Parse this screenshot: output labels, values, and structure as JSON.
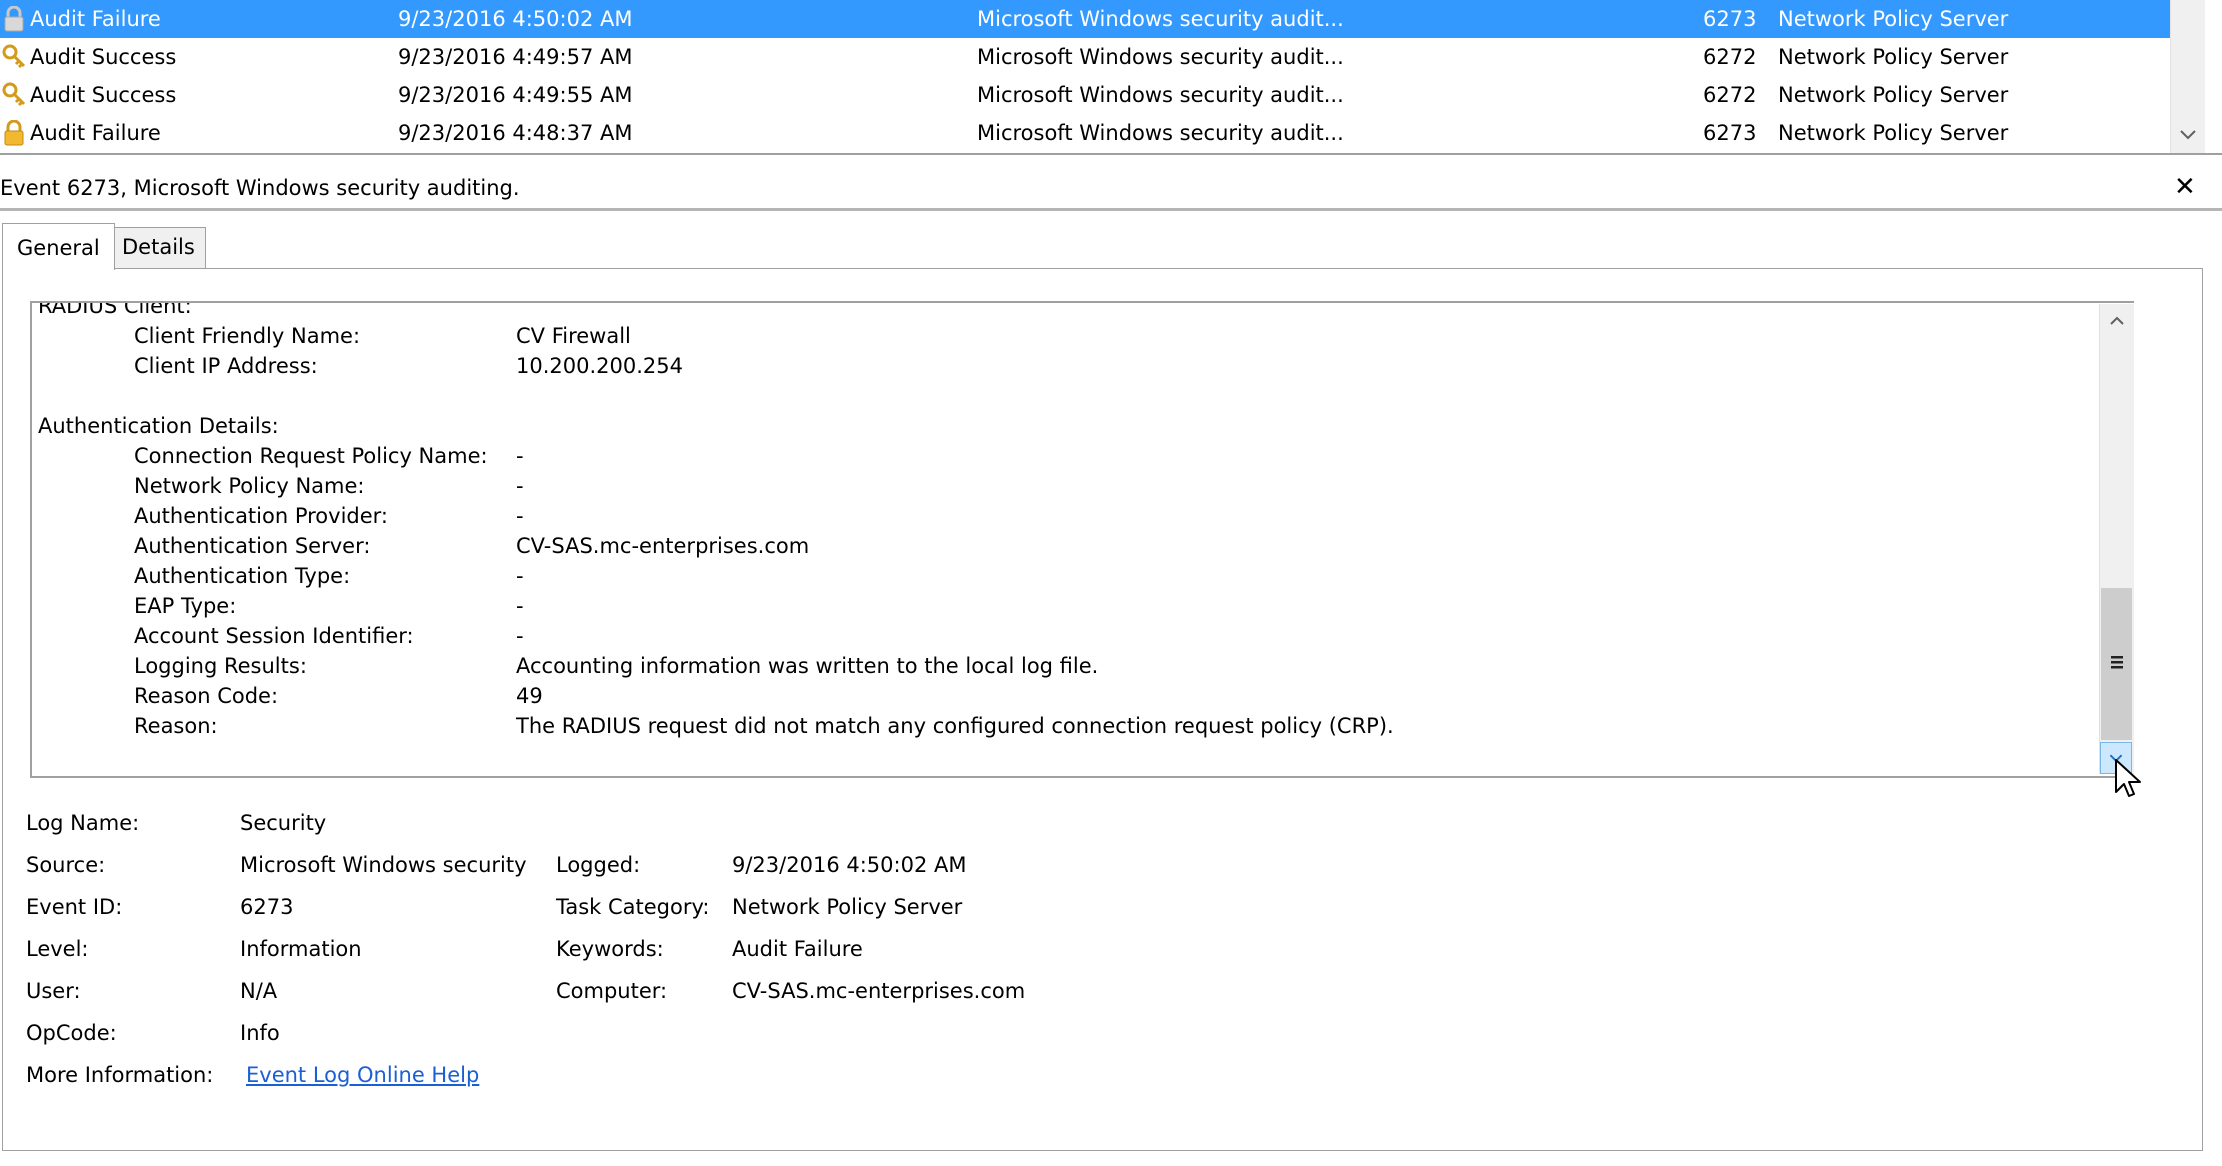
{
  "event_list": {
    "rows": [
      {
        "level": "Audit Failure",
        "date": "9/23/2016 4:50:02 AM",
        "source": "Microsoft Windows security audit...",
        "event_id": "6273",
        "category": "Network Policy Server",
        "icon": "lock-icon",
        "selected": true
      },
      {
        "level": "Audit Success",
        "date": "9/23/2016 4:49:57 AM",
        "source": "Microsoft Windows security audit...",
        "event_id": "6272",
        "category": "Network Policy Server",
        "icon": "key-icon",
        "selected": false
      },
      {
        "level": "Audit Success",
        "date": "9/23/2016 4:49:55 AM",
        "source": "Microsoft Windows security audit...",
        "event_id": "6272",
        "category": "Network Policy Server",
        "icon": "key-icon",
        "selected": false
      },
      {
        "level": "Audit Failure",
        "date": "9/23/2016 4:48:37 AM",
        "source": "Microsoft Windows security audit...",
        "event_id": "6273",
        "category": "Network Policy Server",
        "icon": "lock-icon",
        "selected": false
      }
    ]
  },
  "preview": {
    "title": "Event 6273, Microsoft Windows security auditing.",
    "close_glyph": "✕",
    "tabs": {
      "general": "General",
      "details": "Details"
    },
    "description": {
      "partial_header": "RADIUS Client:",
      "client": [
        {
          "key": "Client Friendly Name:",
          "value": "CV Firewall"
        },
        {
          "key": "Client IP Address:",
          "value": "10.200.200.254"
        }
      ],
      "auth_header": "Authentication Details:",
      "auth": [
        {
          "key": "Connection Request Policy Name:",
          "value": "-"
        },
        {
          "key": "Network Policy Name:",
          "value": "-"
        },
        {
          "key": "Authentication Provider:",
          "value": "-"
        },
        {
          "key": "Authentication Server:",
          "value": "CV-SAS.mc-enterprises.com"
        },
        {
          "key": "Authentication Type:",
          "value": "-"
        },
        {
          "key": "EAP Type:",
          "value": "-"
        },
        {
          "key": "Account Session Identifier:",
          "value": "-"
        },
        {
          "key": "Logging Results:",
          "value": "Accounting information was written to the local log file."
        },
        {
          "key": "Reason Code:",
          "value": "49"
        },
        {
          "key": "Reason:",
          "value": "The RADIUS request did not match any configured connection request policy (CRP)."
        }
      ]
    },
    "properties": {
      "log_name_label": "Log Name:",
      "log_name": "Security",
      "source_label": "Source:",
      "source": "Microsoft Windows security",
      "logged_label": "Logged:",
      "logged": "9/23/2016 4:50:02 AM",
      "event_id_label": "Event ID:",
      "event_id": "6273",
      "task_category_label": "Task Category:",
      "task_category": "Network Policy Server",
      "level_label": "Level:",
      "level": "Information",
      "keywords_label": "Keywords:",
      "keywords": "Audit Failure",
      "user_label": "User:",
      "user": "N/A",
      "computer_label": "Computer:",
      "computer": "CV-SAS.mc-enterprises.com",
      "opcode_label": "OpCode:",
      "opcode": "Info",
      "more_info_label": "More Information:",
      "more_info_link": "Event Log Online Help"
    }
  },
  "colors": {
    "selection": "#3399ff",
    "link": "#1a5fd6",
    "scroll_hover": "#cce8ff"
  }
}
